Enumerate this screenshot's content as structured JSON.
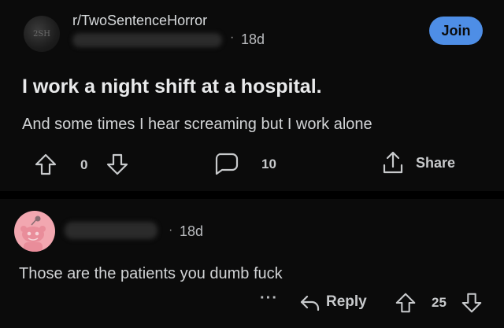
{
  "post": {
    "subreddit": "r/TwoSentenceHorror",
    "avatar_text": "2SH",
    "age": "18d",
    "join_label": "Join",
    "title": "I work a night shift at a hospital.",
    "body": "And some times I hear screaming but I work alone",
    "votes": "0",
    "comments": "10",
    "share_label": "Share"
  },
  "comment": {
    "age": "18d",
    "text": "Those are the patients you dumb fuck",
    "more_label": "···",
    "reply_label": "Reply",
    "votes": "25"
  },
  "colors": {
    "background": "#0b0b0b",
    "join_button": "#4e8ee6",
    "avatar_pink": "#f2a7b0"
  },
  "icons": [
    "upvote-icon",
    "downvote-icon",
    "comment-icon",
    "share-icon",
    "reply-icon"
  ]
}
